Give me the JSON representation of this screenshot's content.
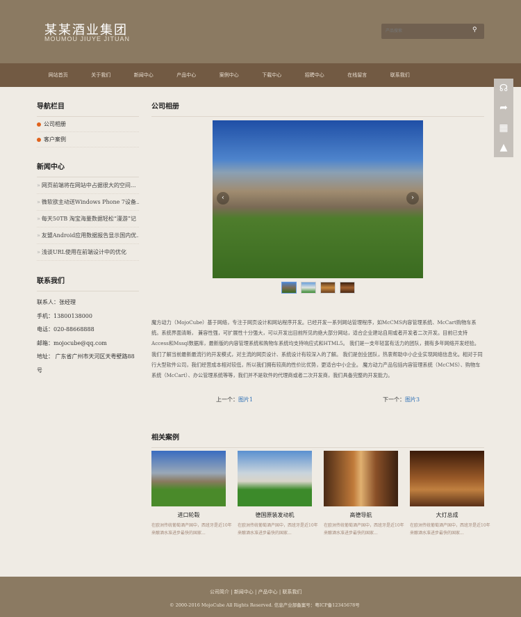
{
  "header": {
    "logo_cn": "某某酒业集团",
    "logo_en": "MOUMOU JIUYE JITUAN",
    "search_placeholder": "产品搜索"
  },
  "nav": [
    "网站首页",
    "关于我们",
    "新闻中心",
    "产品中心",
    "案例中心",
    "下载中心",
    "招聘中心",
    "在线留言",
    "联系我们"
  ],
  "sidebar": {
    "nav_title": "导航栏目",
    "categories": [
      "公司相册",
      "客户案例"
    ],
    "news_title": "新闻中心",
    "news": [
      "网页前端将在网站中占据很大的空间...",
      "微软欲主动送Windows Phone 7设备...",
      "每天50TB 淘宝海量数据轻松“漫游”记",
      "友盟Android应用数据报告显示国内优...",
      "浅谈URL使用在前端设计中的优化"
    ],
    "contact_title": "联系我们",
    "contact": [
      "联系人：张经理",
      "手机：13800138000",
      "电话：020-88668888",
      "邮箱：mojocube@qq.com",
      "地址： 广东省广州市天河区天粤壁路88号"
    ]
  },
  "main": {
    "title": "公司相册",
    "description": "魔方动力（MojoCube）基于网络，专注于网页设计和网站程序开发。已经开发一系列网站管理程序，如McCMS内容管理系统、McCart购物车系统。系统界面清晰， 兼容性强，可扩展性十分强大，可以开发出目前所见的绝大部分网站，适合企业建站自用或者开发者二次开发。目前已支持Access和Mssql数据库，最新版的内容管理系统和购物车系统均支持响应式和HTML5。 我们是一支年轻富有活力的团队，拥有多年网络开发经验。我们了解当前最新最流行的开发模式，对主流的网页设计、系统设计有较深入的了解。 我们是创业团队，热衷帮助中小企业实现网络信息化。相对于同行大型软件公司，我们经营成本相对较低，所以我们拥有较高的性价比优势，更适合中小企业。 魔方动力产品包括内容管理系统（McCMS）、购物车系统（McCart）、办公管理系统等等，我们并不是软件的代理商或者二次开发商，我们具备完整的开发能力。",
    "prev_label": "上一个：",
    "prev_link": "图片1",
    "next_label": "下一个：",
    "next_link": "图片3"
  },
  "related": {
    "title": "相关案例",
    "items": [
      {
        "title": "进口轮毂",
        "desc": "在欧洲传统葡萄酒产国中，西班牙是近10年来酿酒水准进步最快的国家..."
      },
      {
        "title": "德国原装发动机",
        "desc": "在欧洲传统葡萄酒产国中，西班牙是近10年来酿酒水准进步最快的国家..."
      },
      {
        "title": "高德导航",
        "desc": "在欧洲传统葡萄酒产国中，西班牙是近10年来酿酒水准进步最快的国家..."
      },
      {
        "title": "大灯总成",
        "desc": "在欧洲传统葡萄酒产国中，西班牙是近10年来酿酒水准进步最快的国家..."
      }
    ]
  },
  "footer": {
    "links": [
      "公司简介",
      "新闻中心",
      "产品中心",
      "联系我们"
    ],
    "copyright": "© 2000-2016 MojoCube All Rights Reserved. 信息产业部备案号：粤ICP备12345678号"
  }
}
